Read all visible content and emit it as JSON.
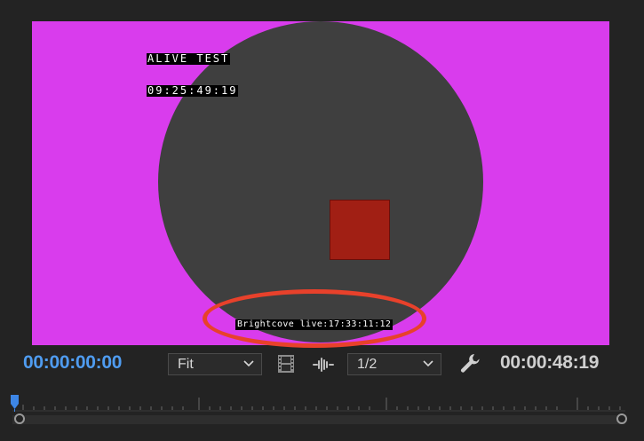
{
  "colors": {
    "frame_bg": "#d93ced",
    "circle": "#3f3f3f",
    "square": "#a11f14",
    "highlight": "#e8412b",
    "timecode_current": "#4f9cf0",
    "timecode_duration": "#cfcfcf",
    "playhead": "#3d86e6"
  },
  "video": {
    "overlay_title": "ALIVE TEST",
    "overlay_timecode": "09:25:49:19",
    "overlay_caption": "Brightcove live:17:33:11:12"
  },
  "controls": {
    "current_timecode": "00:00:00:00",
    "duration_timecode": "00:00:48:19",
    "zoom_value": "Fit",
    "resolution_value": "1/2",
    "icons": [
      "film-icon",
      "audio-waveform-icon",
      "wrench-icon",
      "chevron-down-icon"
    ]
  },
  "timeline": {
    "playhead_position": 0
  }
}
